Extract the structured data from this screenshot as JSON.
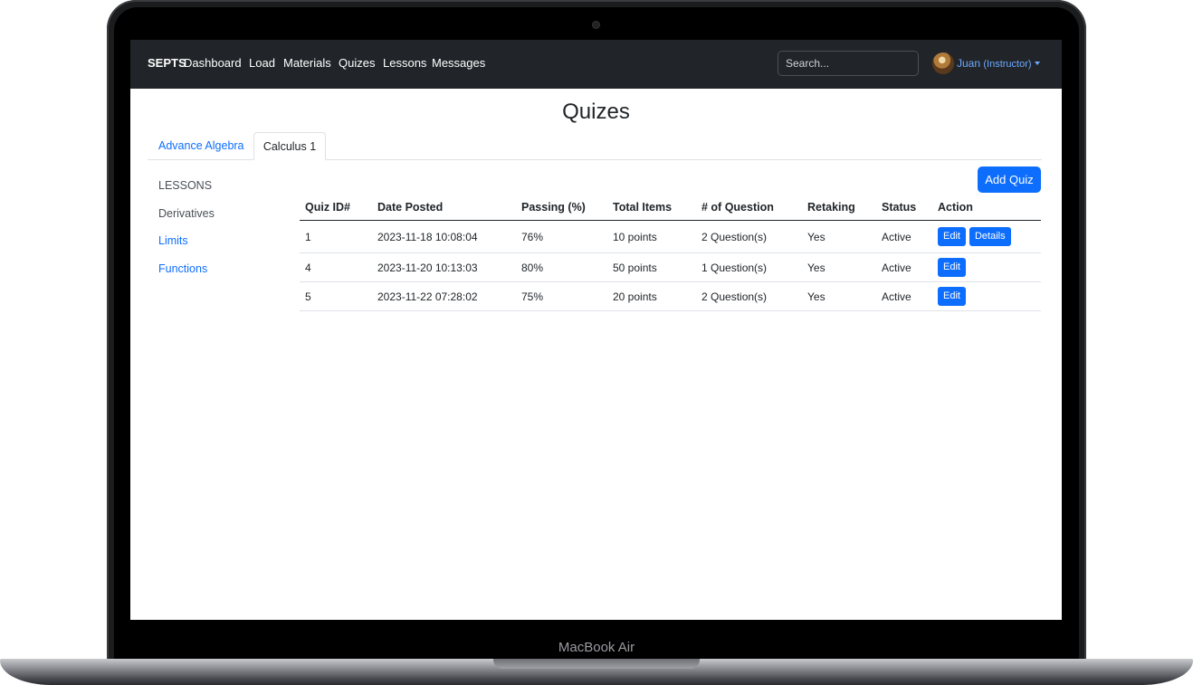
{
  "device_label": "MacBook Air",
  "navbar": {
    "brand": "SEPTS",
    "items": [
      "Dashboard",
      "Load",
      "Materials",
      "Quizes",
      "Lessons",
      "Messages"
    ],
    "search_placeholder": "Search...",
    "user": "Juan",
    "user_role": "(Instructor)"
  },
  "page_title": "Quizes",
  "tabs": [
    {
      "label": "Advance Algebra",
      "active": false
    },
    {
      "label": "Calculus 1",
      "active": true
    }
  ],
  "sidebar": {
    "heading": "LESSONS",
    "items": [
      "Derivatives",
      "Limits",
      "Functions"
    ]
  },
  "add_quiz_label": "Add Quiz",
  "table": {
    "headers": [
      "Quiz ID#",
      "Date Posted",
      "Passing (%)",
      "Total Items",
      "# of Question",
      "Retaking",
      "Status",
      "Action"
    ],
    "rows": [
      {
        "id": "1",
        "date": "2023-11-18 10:08:04",
        "passing": "76%",
        "total": "10 points",
        "questions": "2 Question(s)",
        "retaking": "Yes",
        "status": "Active",
        "actions": [
          "Edit",
          "Details"
        ]
      },
      {
        "id": "4",
        "date": "2023-11-20 10:13:03",
        "passing": "80%",
        "total": "50 points",
        "questions": "1 Question(s)",
        "retaking": "Yes",
        "status": "Active",
        "actions": [
          "Edit"
        ]
      },
      {
        "id": "5",
        "date": "2023-11-22 07:28:02",
        "passing": "75%",
        "total": "20 points",
        "questions": "2 Question(s)",
        "retaking": "Yes",
        "status": "Active",
        "actions": [
          "Edit"
        ]
      }
    ]
  },
  "colors": {
    "navbar_bg": "#212529",
    "primary": "#0d6efd",
    "user_link": "#6ea8fe"
  }
}
